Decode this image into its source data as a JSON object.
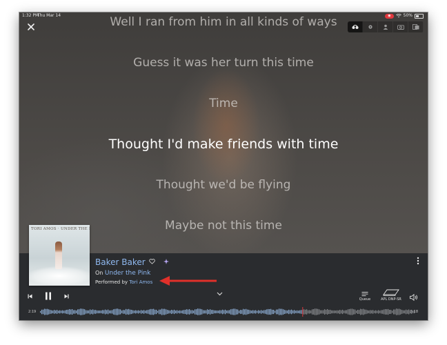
{
  "status_bar": {
    "time": "1:32 PM",
    "date": "Thu Mar 14",
    "recording_indicator": "◉",
    "battery": "50%"
  },
  "lyrics": {
    "lines": [
      "Well I ran from him in all kinds of ways",
      "Guess it was her turn this time",
      "Time",
      "Thought I'd make friends with time",
      "Thought we'd be flying",
      "Maybe not this time"
    ],
    "current_line_index": 3
  },
  "album_art": {
    "title_text": "TORI AMOS · UNDER THE PINK"
  },
  "track": {
    "title": "Baker Baker",
    "album_prefix": "On",
    "album": "Under the Pink",
    "performer_prefix": "Performed by",
    "artist": "Tori Amos"
  },
  "controls": {
    "queue_label": "Queue",
    "device_label": "APL DNP-SR"
  },
  "progress": {
    "elapsed": "2:19",
    "total": "3:18",
    "played_fraction": 0.7
  },
  "colors": {
    "accent_link": "#8fb8ef",
    "playhead": "#e0383e",
    "annotation_arrow": "#e0302a",
    "panel_bg": "#2a2c2f"
  },
  "icons": {
    "close": "close-icon",
    "mode_tabs": [
      "headphones-icon",
      "gear-icon",
      "person-icon",
      "camera-icon",
      "album-icon"
    ],
    "heart": "heart-icon",
    "sparkle": "sparkle-icon",
    "more": "more-vertical-icon",
    "previous": "previous-track-icon",
    "pause": "pause-icon",
    "next": "next-track-icon",
    "expand": "chevron-down-icon",
    "queue": "queue-icon",
    "device": "device-icon",
    "volume": "volume-icon"
  }
}
